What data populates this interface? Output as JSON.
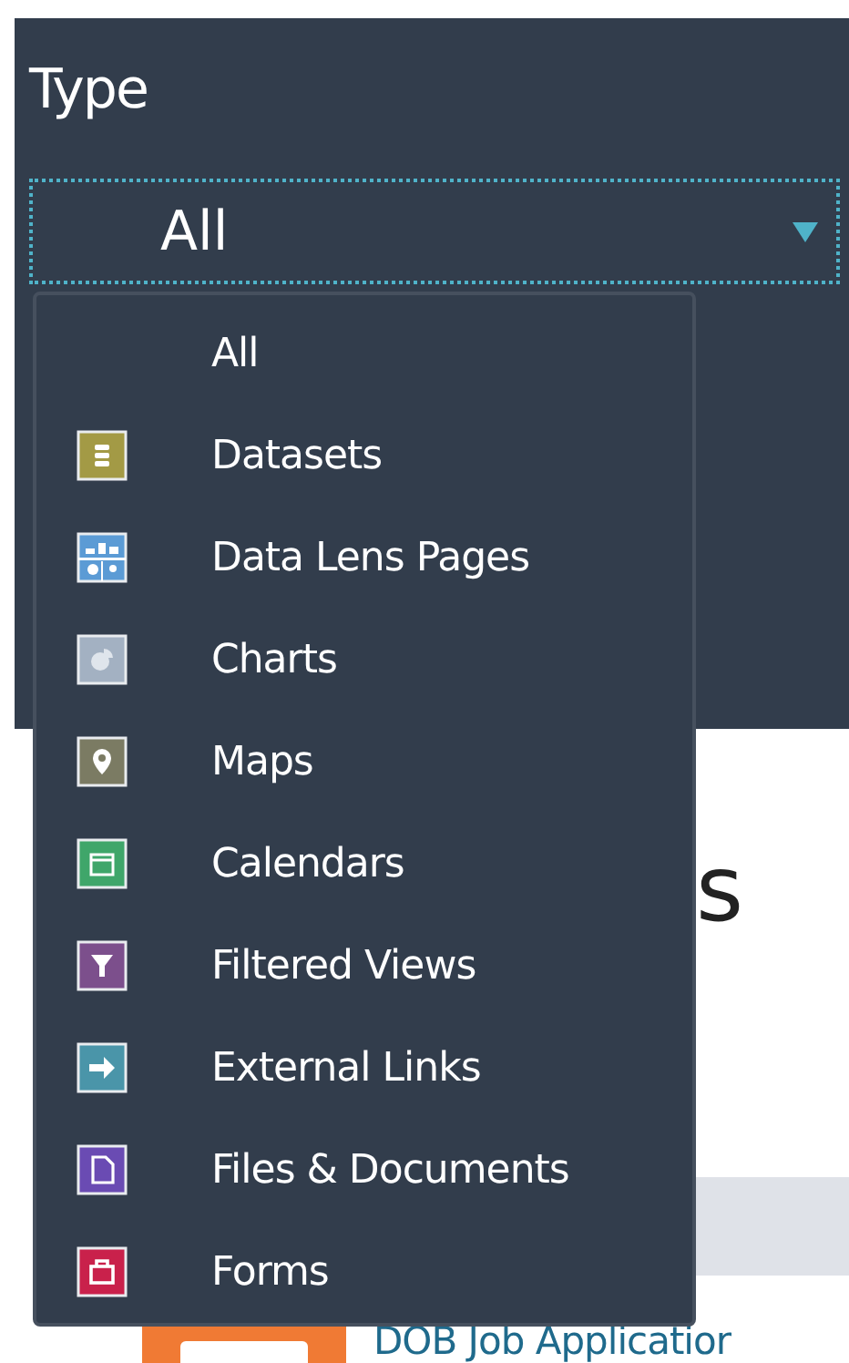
{
  "filter": {
    "label": "Type",
    "value": "All"
  },
  "menu": [
    {
      "kind": "all",
      "label": "All"
    },
    {
      "kind": "dataset",
      "label": "Datasets",
      "color": "#a39a45"
    },
    {
      "kind": "lens",
      "label": "Data Lens Pages",
      "color": "#5b9bd5"
    },
    {
      "kind": "chart",
      "label": "Charts",
      "color": "#a3b1c2"
    },
    {
      "kind": "map",
      "label": "Maps",
      "color": "#7b7b63"
    },
    {
      "kind": "calendar",
      "label": "Calendars",
      "color": "#3fa66a"
    },
    {
      "kind": "filter",
      "label": "Filtered Views",
      "color": "#7c4f8c"
    },
    {
      "kind": "link",
      "label": "External Links",
      "color": "#4a95a9"
    },
    {
      "kind": "file",
      "label": "Files & Documents",
      "color": "#6a4bb3"
    },
    {
      "kind": "form",
      "label": "Forms",
      "color": "#c9214b"
    }
  ],
  "heading": "s",
  "result": {
    "title": "DOB Job Applicatior"
  }
}
